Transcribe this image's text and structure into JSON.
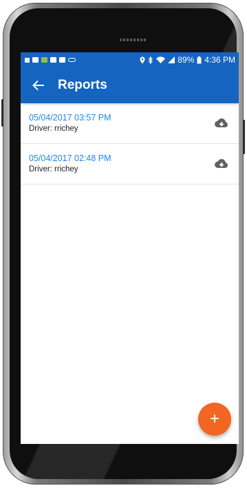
{
  "status_bar": {
    "battery_text": "89%",
    "time": "4:36 PM"
  },
  "app_bar": {
    "back_icon": "arrow-left-icon",
    "title": "Reports"
  },
  "reports": [
    {
      "date": "05/04/2017 03:57 PM",
      "driver": "Driver: rrichey",
      "action_icon": "cloud-download-icon"
    },
    {
      "date": "05/04/2017 02:48 PM",
      "driver": "Driver: rrichey",
      "action_icon": "cloud-download-icon"
    }
  ],
  "fab": {
    "label": "+",
    "icon": "add-icon"
  },
  "colors": {
    "primary": "#1565c0",
    "date_text": "#1e88e5",
    "fab": "#f26522"
  }
}
